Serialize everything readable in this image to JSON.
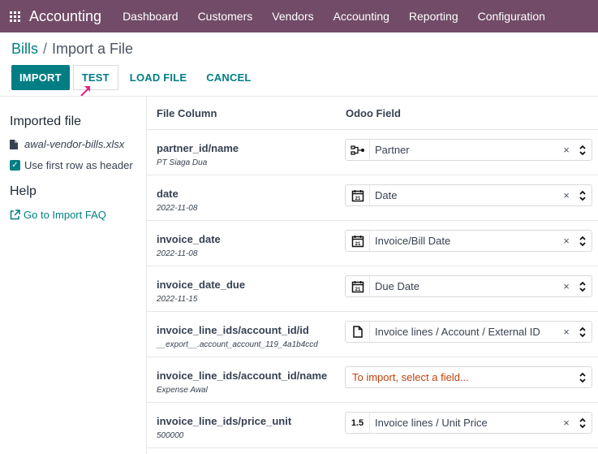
{
  "nav": {
    "app_name": "Accounting",
    "menu": [
      "Dashboard",
      "Customers",
      "Vendors",
      "Accounting",
      "Reporting",
      "Configuration"
    ]
  },
  "breadcrumb": {
    "parent": "Bills",
    "separator": "/",
    "current": "Import a File"
  },
  "buttons": {
    "import": "IMPORT",
    "test": "TEST",
    "load_file": "LOAD FILE",
    "cancel": "CANCEL"
  },
  "sidebar": {
    "imported_title": "Imported file",
    "file_name": "awal-vendor-bills.xlsx",
    "first_row_header": "Use first row as header",
    "first_row_checked": true,
    "help_title": "Help",
    "faq_link": "Go to Import FAQ"
  },
  "table": {
    "col_file": "File Column",
    "col_field": "Odoo Field",
    "rows": [
      {
        "name": "partner_id/name",
        "sample": "PT Siaga Dua",
        "icon": "relation-icon",
        "icon_text": "",
        "field": "Partner"
      },
      {
        "name": "date",
        "sample": "2022-11-08",
        "icon": "calendar-icon",
        "icon_text": "",
        "field": "Date"
      },
      {
        "name": "invoice_date",
        "sample": "2022-11-08",
        "icon": "calendar-icon",
        "icon_text": "",
        "field": "Invoice/Bill Date"
      },
      {
        "name": "invoice_date_due",
        "sample": "2022-11-15",
        "icon": "calendar-icon",
        "icon_text": "",
        "field": "Due Date"
      },
      {
        "name": "invoice_line_ids/account_id/id",
        "sample": "__export__.account_account_119_4a1b4ccd",
        "icon": "document-icon",
        "icon_text": "",
        "field": "Invoice lines / Account / External ID"
      },
      {
        "name": "invoice_line_ids/account_id/name",
        "sample": "Expense Awal",
        "icon": "",
        "icon_text": "",
        "field": "",
        "placeholder": "To import, select a field..."
      },
      {
        "name": "invoice_line_ids/price_unit",
        "sample": "500000",
        "icon": "float-icon",
        "icon_text": "1.5",
        "field": "Invoice lines / Unit Price"
      }
    ]
  },
  "clear_glyph": "×",
  "colors": {
    "navbar": "#714B67",
    "primary": "#017E84",
    "warning_text": "#C2410C"
  }
}
